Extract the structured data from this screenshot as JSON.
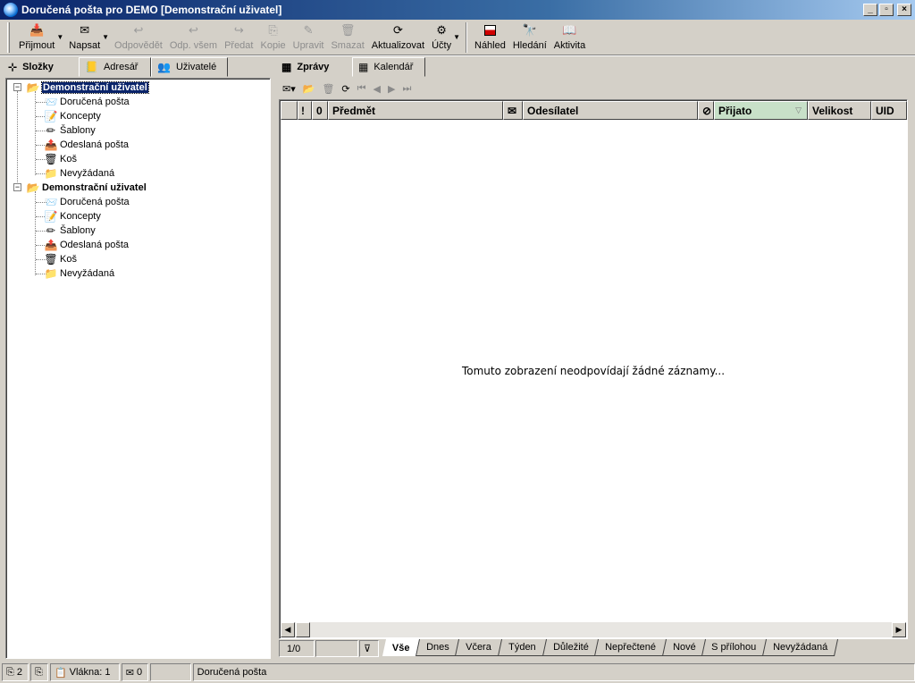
{
  "window": {
    "title": "Doručená pošta pro DEMO [Demonstrační uživatel]"
  },
  "toolbar": {
    "receive": "Přijmout",
    "compose": "Napsat",
    "reply": "Odpovědět",
    "reply_all": "Odp. všem",
    "forward": "Předat",
    "copy": "Kopie",
    "edit": "Upravit",
    "delete": "Smazat",
    "refresh": "Aktualizovat",
    "accounts": "Účty",
    "preview": "Náhled",
    "search": "Hledání",
    "activity": "Aktivita"
  },
  "left_tabs": {
    "folders": "Složky",
    "addressbook": "Adresář",
    "users": "Uživatelé"
  },
  "tree": {
    "account1": {
      "name": "Demonstrační uživatel",
      "folders": [
        "Doručená pošta",
        "Koncepty",
        "Šablony",
        "Odeslaná pošta",
        "Koš",
        "Nevyžádaná"
      ]
    },
    "account2": {
      "name": "Demonstrační uživatel",
      "folders": [
        "Doručená pošta",
        "Koncepty",
        "Šablony",
        "Odeslaná pošta",
        "Koš",
        "Nevyžádaná"
      ]
    }
  },
  "right_tabs": {
    "messages": "Zprávy",
    "calendar": "Kalendář"
  },
  "columns": {
    "importance": "!",
    "attachment": "0",
    "subject": "Předmět",
    "sender": "Odesílatel",
    "received": "Přijato",
    "size": "Velikost",
    "uid": "UID"
  },
  "list": {
    "empty_message": "Tomuto zobrazení neodpovídají žádné záznamy..."
  },
  "filterbar": {
    "page": "1/0",
    "tabs": [
      "Vše",
      "Dnes",
      "Včera",
      "Týden",
      "Důležité",
      "Nepřečtené",
      "Nové",
      "S přílohou",
      "Nevyžádaná"
    ]
  },
  "statusbar": {
    "count1": "2",
    "threads": "Vlákna: 1",
    "mail_count": "0",
    "folder": "Doručená pošta"
  },
  "colors": {
    "title_start": "#0a246a",
    "title_end": "#a6caf0",
    "selection": "#0a246a",
    "sorted_column": "#c8e0c8",
    "face": "#d4d0c8"
  }
}
